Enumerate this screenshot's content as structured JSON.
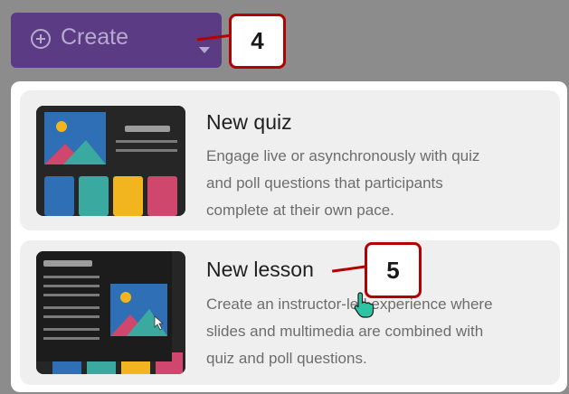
{
  "create_button": {
    "label": "Create",
    "icon": "plus-circle-icon",
    "caret_icon": "chevron-down-icon"
  },
  "callouts": {
    "step_4": "4",
    "step_5": "5"
  },
  "menu": {
    "items": [
      {
        "title": "New quiz",
        "description_lines": [
          "Engage live or asynchronously with quiz",
          "and poll questions that participants",
          "complete at their own pace."
        ]
      },
      {
        "title": "New lesson",
        "description_lines": [
          "Create an instructor-led experience where",
          "slides and multimedia are combined with",
          "quiz and poll questions."
        ]
      }
    ]
  },
  "colors": {
    "create_button_bg": "#5a3b84",
    "callout_border": "#b30000",
    "backdrop": "#8c8c8c"
  }
}
